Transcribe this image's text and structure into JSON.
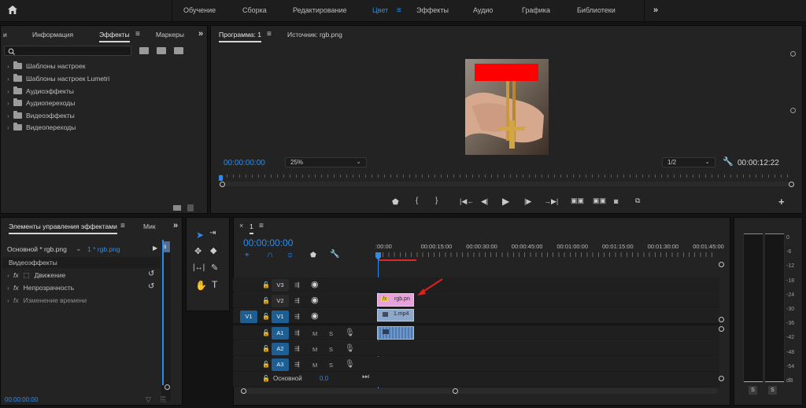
{
  "workspaces": {
    "tabs": [
      "Обучение",
      "Сборка",
      "Редактирование",
      "Цвет",
      "Эффекты",
      "Аудио",
      "Графика",
      "Библиотеки"
    ],
    "active": "Цвет"
  },
  "left_panel": {
    "tabs": [
      "и",
      "Информация",
      "Эффекты",
      "Маркеры"
    ],
    "active": "Эффекты",
    "tree": [
      "Шаблоны настроек",
      "Шаблоны настроек Lumetri",
      "Аудиоэффекты",
      "Аудиопереходы",
      "Видеоэффекты",
      "Видеопереходы"
    ]
  },
  "monitor": {
    "tabs": [
      "Программа: 1",
      "Источник: rgb.png"
    ],
    "timecode": "00:00:00:00",
    "zoom": "25%",
    "resolution": "1/2",
    "duration": "00:00:12:22",
    "redact_color": "#ff0000"
  },
  "effect_controls": {
    "tabs": [
      "Элементы управления эффектами",
      "Мик"
    ],
    "master": "Основной * rgb.png",
    "clip": "1 * rgb.png",
    "section": "Видеоэффекты",
    "rows": [
      "Движение",
      "Непрозрачность",
      "Изменение времени"
    ],
    "footer_time": "00:00:00:00",
    "side_label": "rg"
  },
  "timeline": {
    "seq_tab": "1",
    "timecode": "00:00:00:00",
    "ruler": [
      ":00:00",
      "00:00:15:00",
      "00:00:30:00",
      "00:00:45:00",
      "00:01:00:00",
      "00:01:15:00",
      "00:01:30:00",
      "00:01:45:00"
    ],
    "video_tracks": [
      {
        "name": "V3"
      },
      {
        "name": "V2"
      },
      {
        "name": "V1",
        "src": "V1"
      }
    ],
    "audio_tracks": [
      {
        "name": "A1"
      },
      {
        "name": "A2"
      },
      {
        "name": "A3"
      }
    ],
    "track_letters": {
      "m": "M",
      "s": "S"
    },
    "master": {
      "label": "Основной",
      "value": "0,0"
    },
    "clips": {
      "v2": {
        "fx": "fx",
        "name": "rgb.pn"
      },
      "v1": {
        "name": "1.mp4"
      }
    }
  },
  "audio_meter": {
    "scale": [
      "0",
      "-6",
      "-12",
      "-18",
      "-24",
      "-30",
      "-36",
      "-42",
      "-48",
      "-54",
      "dB"
    ],
    "solo": [
      "S",
      "S"
    ]
  }
}
